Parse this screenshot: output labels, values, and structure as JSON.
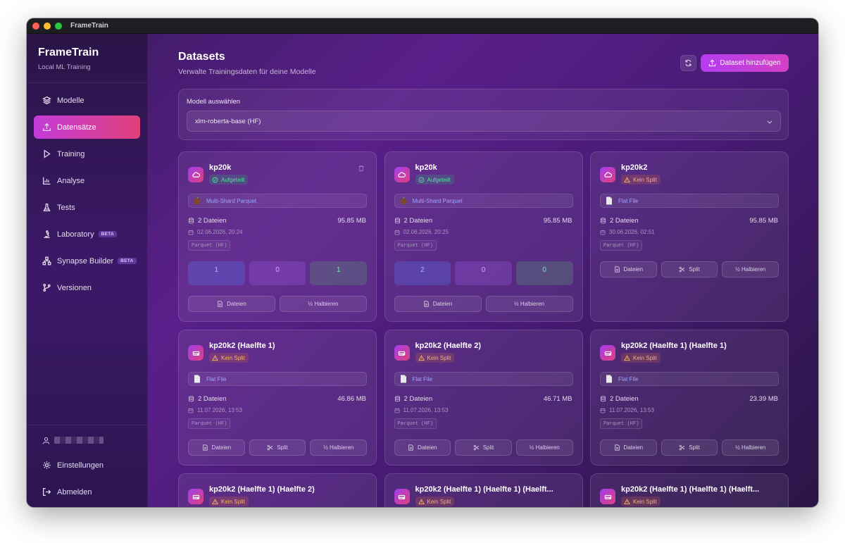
{
  "window": {
    "title": "FrameTrain"
  },
  "brand": {
    "name": "FrameTrain",
    "subtitle": "Local ML Training"
  },
  "nav": {
    "items": [
      {
        "label": "Modelle",
        "icon": "layers-icon"
      },
      {
        "label": "Datensätze",
        "icon": "upload-icon",
        "active": true
      },
      {
        "label": "Training",
        "icon": "play-icon"
      },
      {
        "label": "Analyse",
        "icon": "bar-chart-icon"
      },
      {
        "label": "Tests",
        "icon": "flask-icon"
      },
      {
        "label": "Laboratory",
        "icon": "microscope-icon",
        "badge": "BETA"
      },
      {
        "label": "Synapse Builder",
        "icon": "network-icon",
        "badge": "BETA"
      },
      {
        "label": "Versionen",
        "icon": "git-branch-icon"
      }
    ],
    "settings": "Einstellungen",
    "logout": "Abmelden"
  },
  "header": {
    "title": "Datasets",
    "subtitle": "Verwalte Trainingsdaten für deine Modelle",
    "add_button": "Dataset hinzufügen"
  },
  "model_select": {
    "label": "Modell auswählen",
    "value": "xlm-roberta-base (HF)"
  },
  "buttons": {
    "files": "Dateien",
    "split": "Split",
    "halve": "½ Halbieren"
  },
  "datasets": [
    {
      "name": "kp20k",
      "status": "Aufgeteilt",
      "status_type": "ok",
      "format": "Multi-Shard Parquet",
      "files": "2 Dateien",
      "size": "95.85 MB",
      "date": "02.06.2026, 20:24",
      "tag": "Parquet (HF)",
      "splits": [
        "1",
        "0",
        "1"
      ]
    },
    {
      "name": "kp20k",
      "status": "Aufgeteilt",
      "status_type": "ok",
      "format": "Multi-Shard Parquet",
      "files": "2 Dateien",
      "size": "95.85 MB",
      "date": "02.06.2026, 20:25",
      "tag": "Parquet (HF)",
      "splits": [
        "2",
        "0",
        "0"
      ]
    },
    {
      "name": "kp20k2",
      "status": "Kein Split",
      "status_type": "warn",
      "format": "Flat File",
      "files": "2 Dateien",
      "size": "95.85 MB",
      "date": "30.06.2026, 02:51",
      "tag": "Parquet (HF)"
    },
    {
      "name": "kp20k2 (Haelfte 1)",
      "status": "Kein Split",
      "status_type": "warn",
      "format": "Flat File",
      "files": "2 Dateien",
      "size": "46.86 MB",
      "date": "11.07.2026, 13:53",
      "tag": "Parquet (HF)"
    },
    {
      "name": "kp20k2 (Haelfte 2)",
      "status": "Kein Split",
      "status_type": "warn",
      "format": "Flat File",
      "files": "2 Dateien",
      "size": "46.71 MB",
      "date": "11.07.2026, 13:53",
      "tag": "Parquet (HF)"
    },
    {
      "name": "kp20k2 (Haelfte 1) (Haelfte 1)",
      "status": "Kein Split",
      "status_type": "warn",
      "format": "Flat File",
      "files": "2 Dateien",
      "size": "23.39 MB",
      "date": "11.07.2026, 13:53",
      "tag": "Parquet (HF)"
    },
    {
      "name": "kp20k2 (Haelfte 1) (Haelfte 2)",
      "status": "Kein Split",
      "status_type": "warn"
    },
    {
      "name": "kp20k2 (Haelfte 1) (Haelfte 1) (Haelft...",
      "status": "Kein Split",
      "status_type": "warn"
    },
    {
      "name": "kp20k2 (Haelfte 1) (Haelfte 1) (Haelft...",
      "status": "Kein Split",
      "status_type": "warn"
    }
  ]
}
